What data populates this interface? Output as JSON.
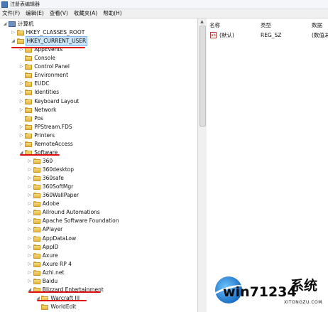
{
  "window": {
    "title": "注册表编辑器"
  },
  "menu": [
    "文件(F)",
    "编辑(E)",
    "查看(V)",
    "收藏夹(A)",
    "帮助(H)"
  ],
  "tree": {
    "root": "计算机",
    "rows": [
      {
        "label": "HKEY_CLASSES_ROOT",
        "depth": 1,
        "expander": "▷"
      },
      {
        "label": "HKEY_CURRENT_USER",
        "depth": 1,
        "expander": "◢"
      },
      {
        "label": "AppEvents",
        "depth": 2,
        "expander": "▷"
      },
      {
        "label": "Console",
        "depth": 2,
        "expander": ""
      },
      {
        "label": "Control Panel",
        "depth": 2,
        "expander": "▷"
      },
      {
        "label": "Environment",
        "depth": 2,
        "expander": ""
      },
      {
        "label": "EUDC",
        "depth": 2,
        "expander": "▷"
      },
      {
        "label": "Identities",
        "depth": 2,
        "expander": "▷"
      },
      {
        "label": "Keyboard Layout",
        "depth": 2,
        "expander": "▷"
      },
      {
        "label": "Network",
        "depth": 2,
        "expander": "▷"
      },
      {
        "label": "Pos",
        "depth": 2,
        "expander": ""
      },
      {
        "label": "PPStream.FDS",
        "depth": 2,
        "expander": "▷"
      },
      {
        "label": "Printers",
        "depth": 2,
        "expander": "▷"
      },
      {
        "label": "RemoteAccess",
        "depth": 2,
        "expander": "▷"
      },
      {
        "label": "Software",
        "depth": 2,
        "expander": "◢"
      },
      {
        "label": "360",
        "depth": 3,
        "expander": "▷"
      },
      {
        "label": "360desktop",
        "depth": 3,
        "expander": "▷"
      },
      {
        "label": "360safe",
        "depth": 3,
        "expander": "▷"
      },
      {
        "label": "360SoftMgr",
        "depth": 3,
        "expander": "▷"
      },
      {
        "label": "360WallPaper",
        "depth": 3,
        "expander": "▷"
      },
      {
        "label": "Adobe",
        "depth": 3,
        "expander": "▷"
      },
      {
        "label": "Allround Automations",
        "depth": 3,
        "expander": "▷"
      },
      {
        "label": "Apache Software Foundation",
        "depth": 3,
        "expander": "▷"
      },
      {
        "label": "APlayer",
        "depth": 3,
        "expander": "▷"
      },
      {
        "label": "AppDataLow",
        "depth": 3,
        "expander": "▷"
      },
      {
        "label": "AppID",
        "depth": 3,
        "expander": "▷"
      },
      {
        "label": "Axure",
        "depth": 3,
        "expander": "▷"
      },
      {
        "label": "Axure RP 4",
        "depth": 3,
        "expander": "▷"
      },
      {
        "label": "Azhi.net",
        "depth": 3,
        "expander": "▷"
      },
      {
        "label": "Baidu",
        "depth": 3,
        "expander": "▷"
      },
      {
        "label": "Blizzard Entertainment",
        "depth": 3,
        "expander": "◢"
      },
      {
        "label": "Warcraft III",
        "depth": 4,
        "expander": "◢"
      },
      {
        "label": "WorldEdit",
        "depth": 4,
        "expander": ""
      }
    ]
  },
  "list": {
    "columns": [
      "名称",
      "类型",
      "数据"
    ],
    "rows": [
      {
        "icon": "ab",
        "name": "(默认)",
        "type": "REG_SZ",
        "data": "(数值未"
      }
    ]
  },
  "watermark": {
    "main": "win71234",
    "cn": "系统",
    "site": "XITONGZU.COM"
  }
}
